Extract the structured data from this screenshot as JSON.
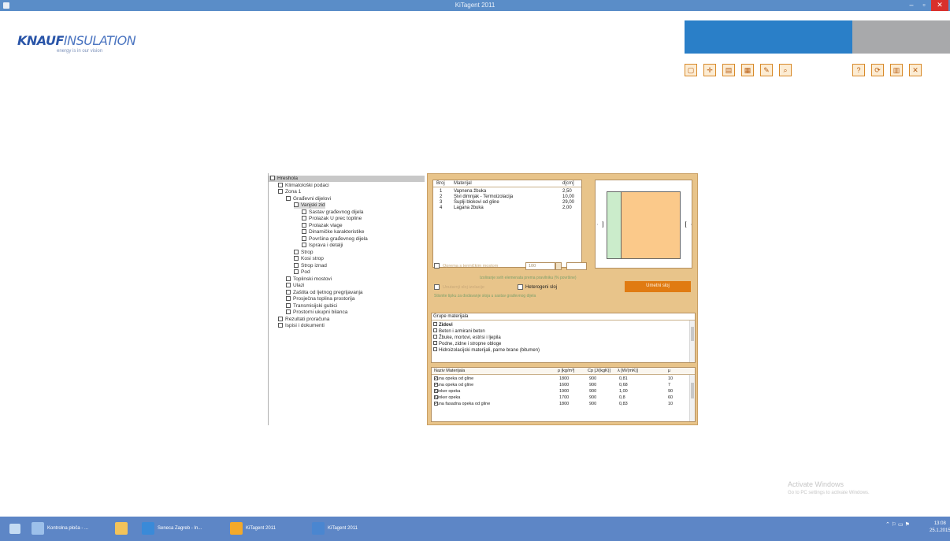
{
  "window": {
    "title": "KiTagent 2011"
  },
  "logo": {
    "brand_bold": "KNAUF",
    "brand_thin": "INSULATION",
    "slogan": "energy is in our vision"
  },
  "toolbar": {
    "buttons": [
      {
        "name": "new-project-icon",
        "glyph": "▢"
      },
      {
        "name": "settings-icon",
        "glyph": "✛"
      },
      {
        "name": "open-icon",
        "glyph": "▤"
      },
      {
        "name": "save-icon",
        "glyph": "▦"
      },
      {
        "name": "edit-icon",
        "glyph": "✎"
      },
      {
        "name": "print-preview-icon",
        "glyph": "⌕"
      },
      {
        "name": "help-icon",
        "glyph": "?"
      },
      {
        "name": "refresh-icon",
        "glyph": "⟳"
      },
      {
        "name": "document-icon",
        "glyph": "▥"
      },
      {
        "name": "exit-icon",
        "glyph": "✕"
      }
    ]
  },
  "tree": [
    {
      "label": "Hreshola",
      "level": 0
    },
    {
      "label": "Klimatološki podaci",
      "level": 1
    },
    {
      "label": "Zona 1",
      "level": 1
    },
    {
      "label": "Građevni dijelovi",
      "level": 2
    },
    {
      "label": "Vanjski zid",
      "level": 3
    },
    {
      "label": "Sastav građevnog dijela",
      "level": 4
    },
    {
      "label": "Prolazak U prec topline",
      "level": 4
    },
    {
      "label": "Prolazak vlage",
      "level": 4
    },
    {
      "label": "Dinamičke karakteristike",
      "level": 4
    },
    {
      "label": "Površina građevnog dijela",
      "level": 4
    },
    {
      "label": "Isprava i detalji",
      "level": 4
    },
    {
      "label": "Strop",
      "level": 3
    },
    {
      "label": "Kosi strop",
      "level": 3
    },
    {
      "label": "Strop iznad",
      "level": 3
    },
    {
      "label": "Pod",
      "level": 3
    },
    {
      "label": "Toplinski mostovi",
      "level": 2
    },
    {
      "label": "Ulazi",
      "level": 2
    },
    {
      "label": "Zaštita od ljetnog pregrijavanja",
      "level": 2
    },
    {
      "label": "Prosječna toplina prostorija",
      "level": 2
    },
    {
      "label": "Transmisijski gubici",
      "level": 2
    },
    {
      "label": "Prostorni ukupni bilanca",
      "level": 2
    },
    {
      "label": "Rezultati proračuna",
      "level": 1
    },
    {
      "label": "Ispisi i dokumenti",
      "level": 1
    }
  ],
  "layers": {
    "headers": {
      "no": "Broj",
      "material": "Materijal",
      "thickness": "d[cm]"
    },
    "rows": [
      {
        "no": "1",
        "material": "Vapnena žbuka",
        "thickness": "2,50"
      },
      {
        "no": "2",
        "material": "Sivi dimnjak - Termoizolacija",
        "thickness": "10,00"
      },
      {
        "no": "3",
        "material": "Šuplji blokovi od gline",
        "thickness": "29,00"
      },
      {
        "no": "4",
        "material": "Lagana žbuka",
        "thickness": "2,00"
      }
    ]
  },
  "options": {
    "option1_label": "Oprema s termičkim mostom",
    "spinner_value": "100",
    "note1": "Izoliranje svih elemenata prema pravilniku (% površine)",
    "option2_label": "Unutarnji sloj izolacije",
    "hetero_label": "Heterogeni sloj",
    "note2": "Stisnite tipku za dodavanje sloja u sastav građevnog dijela",
    "button_label": "Umetni sloj"
  },
  "groups": {
    "title": "Grupe materijala",
    "items": [
      "Zidovi",
      "Beton i armirani beton",
      "Žbuke, mortovi, estrisi i ljepila",
      "Podne, zidne i stropne obloge",
      "Hidroizolacijski materijali, parne brane (bitumen)"
    ]
  },
  "materials": {
    "headers": {
      "name": "Naziv Materijala",
      "rho": "ρ [kg/m³]",
      "cp": "Cp [J/(kgK)]",
      "lambda": "λ [W/(mK)]",
      "mu": "μ"
    },
    "rows": [
      {
        "name": "Puna opeka od gline",
        "rho": "1800",
        "cp": "900",
        "lambda": "0,81",
        "mu": "10"
      },
      {
        "name": "Puna opeka od gline",
        "rho": "1600",
        "cp": "900",
        "lambda": "0,68",
        "mu": "7"
      },
      {
        "name": "Klinker opeka",
        "rho": "1900",
        "cp": "900",
        "lambda": "1,00",
        "mu": "90"
      },
      {
        "name": "Klinker opeka",
        "rho": "1700",
        "cp": "900",
        "lambda": "0,8",
        "mu": "60"
      },
      {
        "name": "Puna fasadna opeka od gline",
        "rho": "1800",
        "cp": "900",
        "lambda": "0,83",
        "mu": "10"
      }
    ]
  },
  "watermark": {
    "line1": "Activate Windows",
    "line2": "Go to PC settings to activate Windows."
  },
  "taskbar": {
    "items": [
      {
        "label": "Kontrolna ploča - ...",
        "color": "#9cc0ea"
      },
      {
        "label": "",
        "color": "#f3c35a"
      },
      {
        "label": "Seneca Zagreb - In...",
        "color": "#3a8ad8"
      },
      {
        "label": "KiTagent 2011",
        "color": "#f3a92a"
      },
      {
        "label": "KiTagent 2011",
        "color": "#4a86d0"
      }
    ],
    "tray": "⌃ ⚐ ▭ ⚑",
    "time": "13:08",
    "date": "25.1.2015"
  },
  "colors": {
    "title_bar": "#5a8dc8",
    "panel": "#e8c48a",
    "accent_orange": "#e07b12",
    "header_blue": "#2a7fc8",
    "header_gray": "#a8a9ab",
    "taskbar": "#5d86c6"
  }
}
